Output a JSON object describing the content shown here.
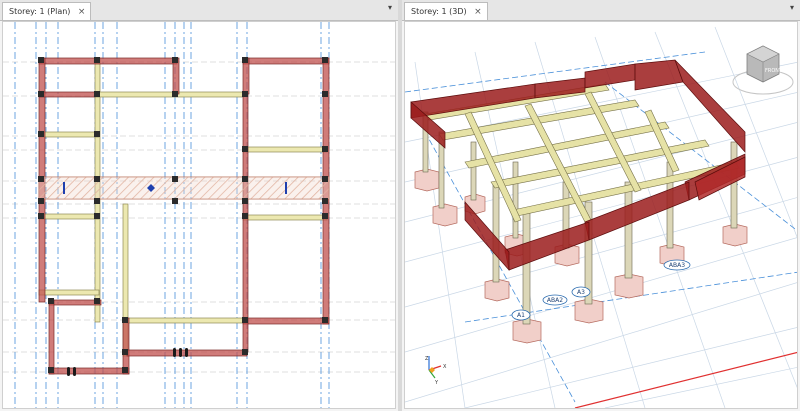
{
  "tabs": {
    "plan": {
      "label": "Storey: 1 (Plan)",
      "close_glyph": "×",
      "menu_glyph": "▾"
    },
    "view3d": {
      "label": "Storey: 1 (3D)",
      "close_glyph": "×",
      "menu_glyph": "▾"
    }
  },
  "viewcube": {
    "face_label": "FRONT"
  },
  "axis_triad": {
    "z": "Z",
    "x": "X",
    "y": "Y"
  },
  "grid_labels": [
    "A1",
    "ABA2",
    "A3",
    "ABA3"
  ],
  "colors": {
    "beam_red": "#c0504d",
    "beam_yellow": "#e8e4a6",
    "grid_blue": "#4a90d9",
    "column": "#6a6a6a"
  }
}
